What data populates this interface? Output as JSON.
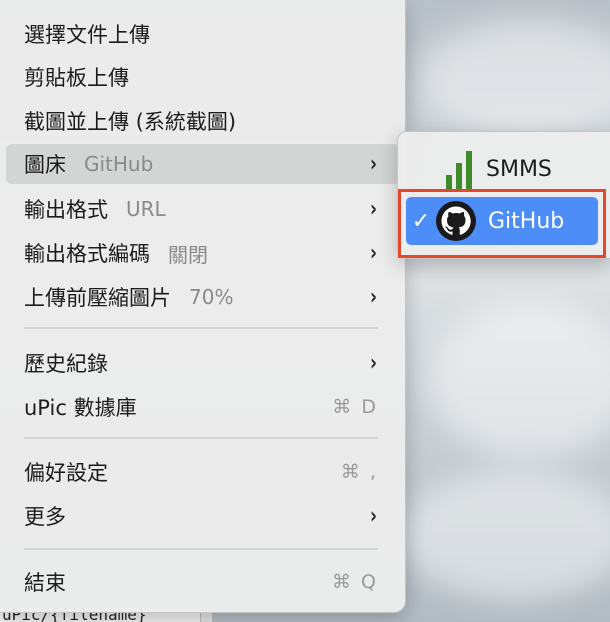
{
  "menu": {
    "items": [
      {
        "label": "選擇文件上傳"
      },
      {
        "label": "剪貼板上傳"
      },
      {
        "label": "截圖並上傳 (系統截圖)"
      },
      {
        "label": "圖床",
        "value": "GitHub",
        "arrow": "›"
      },
      {
        "label": "輸出格式",
        "value": "URL",
        "arrow": "›"
      },
      {
        "label": "輸出格式編碼",
        "value": "關閉",
        "arrow": "›"
      },
      {
        "label": "上傳前壓縮圖片",
        "value": "70%",
        "arrow": "›"
      },
      {
        "label": "歷史紀錄",
        "arrow": "›"
      },
      {
        "label": "uPic 數據庫",
        "shortcut": "⌘ D"
      },
      {
        "label": "偏好設定",
        "shortcut": "⌘ ,"
      },
      {
        "label": "更多",
        "arrow": "›"
      },
      {
        "label": "結束",
        "shortcut": "⌘ Q"
      }
    ]
  },
  "submenu": {
    "items": [
      {
        "label": "SMMS",
        "icon": "bar-chart-icon",
        "color": "#3f8a2a"
      },
      {
        "label": "GitHub",
        "icon": "github-icon",
        "checkmark": "✓",
        "selected": true
      }
    ],
    "selection_color": "#4c8df7",
    "annotation_color": "#e5472d"
  },
  "background": {
    "strip_text": "uPic/{filename}"
  }
}
